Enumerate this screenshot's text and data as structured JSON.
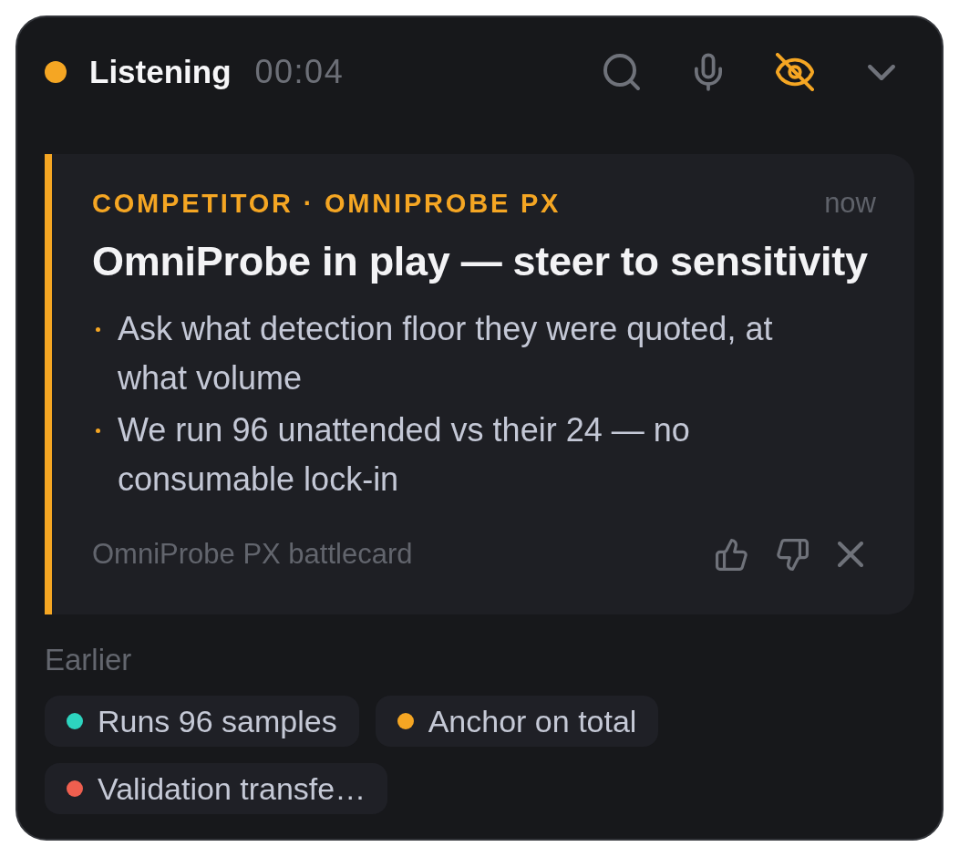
{
  "status": {
    "label": "Listening",
    "timer": "00:04"
  },
  "toolbar": [
    {
      "kind": "search",
      "on": false
    },
    {
      "kind": "mic",
      "on": false
    },
    {
      "kind": "hide",
      "on": true
    },
    {
      "kind": "collapse",
      "on": false
    }
  ],
  "card": {
    "tag": "COMPETITOR · OMNIPROBE PX",
    "time": "now",
    "title": "OmniProbe in play — steer to sensitivity",
    "bullets": [
      "Ask what detection floor they were quoted, at what volume",
      "We run 96 unattended vs their 24 — no consumable lock-in"
    ],
    "source": "OmniProbe PX battlecard"
  },
  "earlier": {
    "heading": "Earlier",
    "items": [
      {
        "label": "Runs 96 samples",
        "color": "#2dd4bf"
      },
      {
        "label": "Anchor on total",
        "color": "#f5a623"
      },
      {
        "label": "Validation transfe…",
        "color": "#ef5f4f"
      }
    ]
  }
}
